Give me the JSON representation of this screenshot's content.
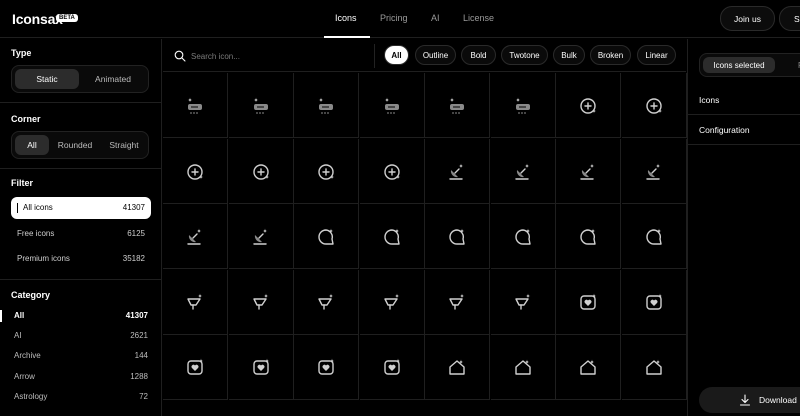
{
  "header": {
    "logo": "Iconsax",
    "badge": "BETA",
    "nav": [
      "Icons",
      "Pricing",
      "AI",
      "License"
    ],
    "join_label": "Join us",
    "s_label": "S"
  },
  "sidebar": {
    "type_title": "Type",
    "type_options": [
      "Static",
      "Animated"
    ],
    "corner_title": "Corner",
    "corner_options": [
      "All",
      "Rounded",
      "Straight"
    ],
    "filter_title": "Filter",
    "filters": [
      {
        "label": "All icons",
        "count": "41307"
      },
      {
        "label": "Free icons",
        "count": "6125"
      },
      {
        "label": "Premium icons",
        "count": "35182"
      }
    ],
    "category_title": "Category",
    "categories": [
      {
        "label": "All",
        "count": "41307"
      },
      {
        "label": "AI",
        "count": "2621"
      },
      {
        "label": "Archive",
        "count": "144"
      },
      {
        "label": "Arrow",
        "count": "1288"
      },
      {
        "label": "Astrology",
        "count": "72"
      }
    ]
  },
  "search": {
    "placeholder": "Search icon..."
  },
  "styles": [
    "All",
    "Outline",
    "Bold",
    "Twotone",
    "Bulk",
    "Broken",
    "Linear"
  ],
  "icon_rows": [
    [
      "cloud-rain-sparkle",
      "cloud-rain-sparkle",
      "cloud-rain-sparkle",
      "cloud-rain-sparkle",
      "cloud-rain-sparkle",
      "cloud-rain-sparkle",
      "add-circle-sparkle",
      "add-circle-sparkle"
    ],
    [
      "add-circle-sparkle",
      "add-circle-sparkle",
      "add-circle-sparkle",
      "add-circle-sparkle",
      "satellite-dish-sparkle",
      "satellite-dish-sparkle",
      "satellite-dish-sparkle",
      "satellite-dish-sparkle"
    ],
    [
      "satellite-dish-sparkle",
      "satellite-dish-sparkle",
      "chat-bubble-sparkle",
      "chat-bubble-sparkle",
      "chat-bubble-sparkle",
      "chat-bubble-sparkle",
      "chat-bubble-sparkle",
      "chat-bubble-sparkle"
    ],
    [
      "megaphone-sparkle",
      "megaphone-sparkle",
      "megaphone-sparkle",
      "megaphone-sparkle",
      "megaphone-sparkle",
      "megaphone-sparkle",
      "heart-square-sparkle",
      "heart-square-sparkle"
    ],
    [
      "heart-square-sparkle",
      "heart-square-sparkle",
      "heart-square-sparkle",
      "heart-square-sparkle",
      "home-sparkle",
      "home-sparkle",
      "home-sparkle",
      "home-sparkle"
    ]
  ],
  "right_panel": {
    "tabs": [
      "Icons selected",
      "Pro"
    ],
    "sections": [
      "Icons",
      "Configuration"
    ],
    "download_label": "Download"
  }
}
